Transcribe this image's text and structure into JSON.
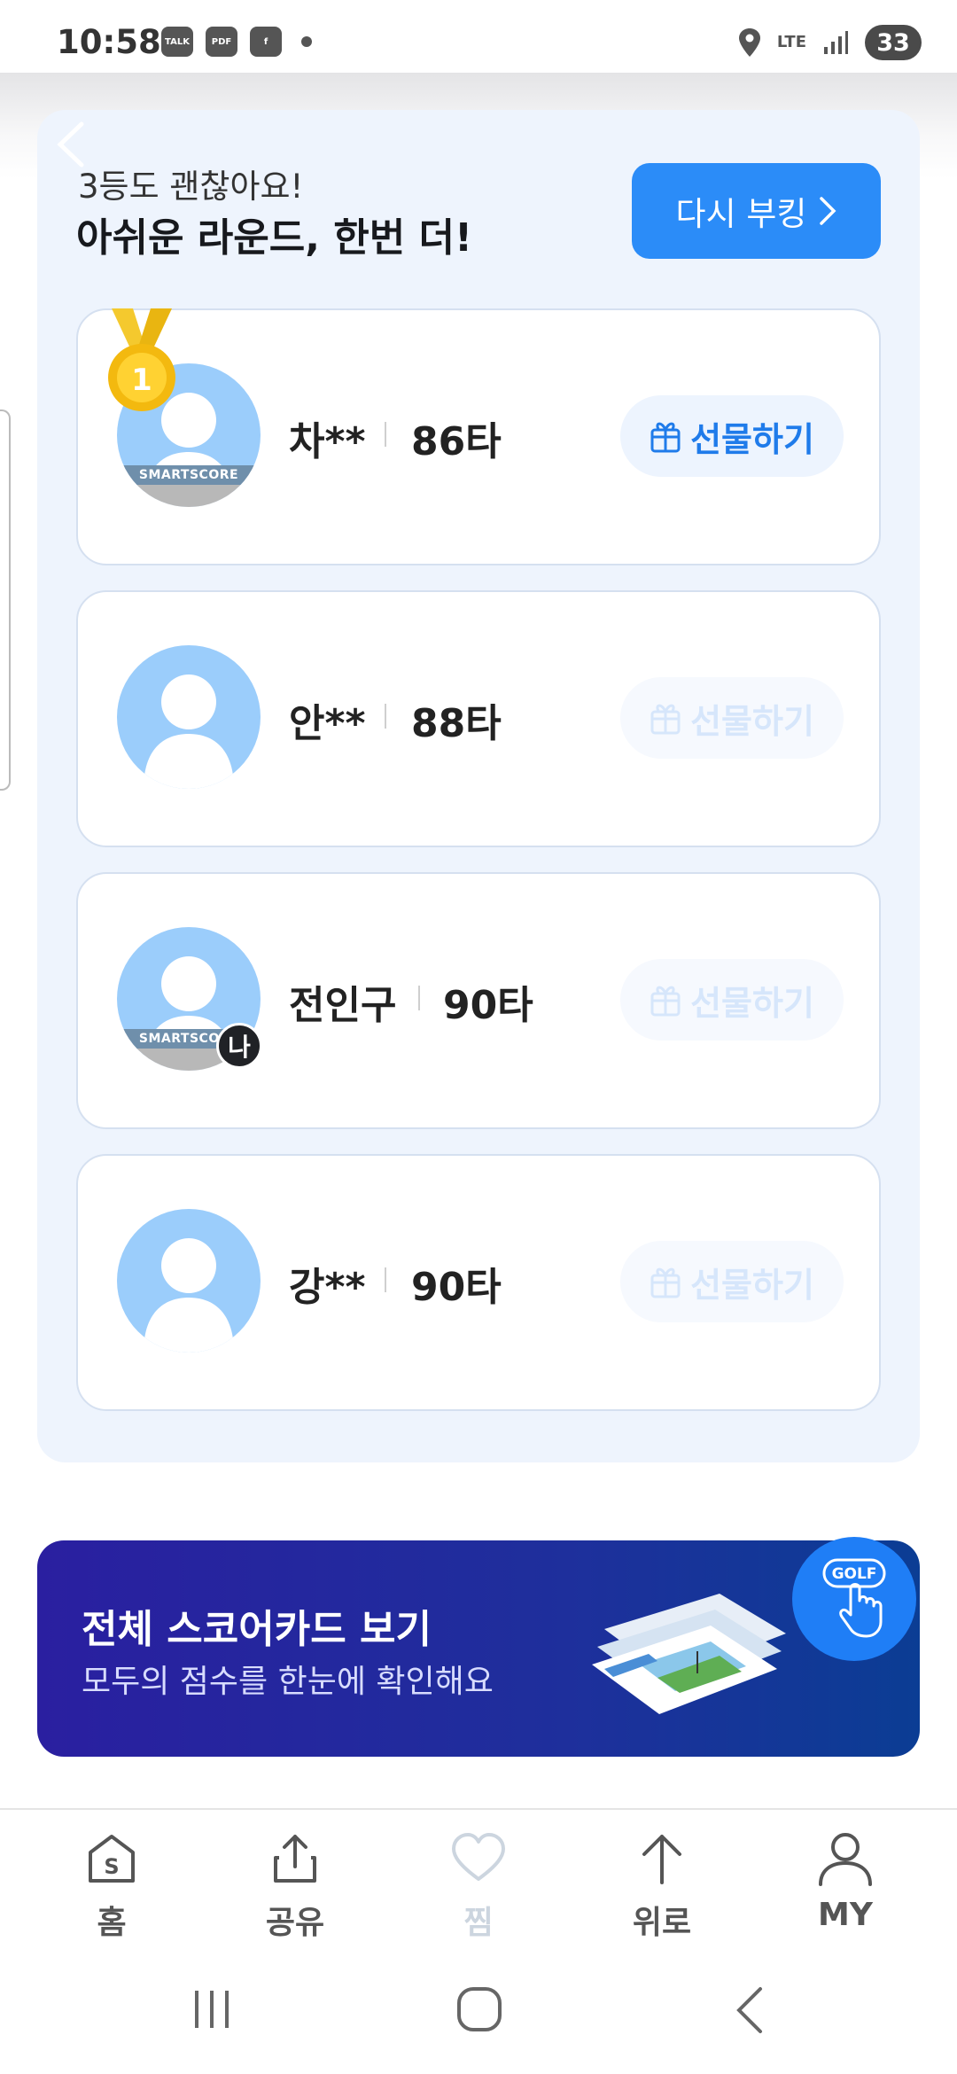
{
  "status_bar": {
    "time": "10:58",
    "network": "LTE",
    "battery": "33",
    "icons": [
      "talk-icon",
      "pdf-icon",
      "facebook-chat-icon",
      "location-icon",
      "signal-icon"
    ]
  },
  "header": {
    "subtitle": "3등도 괜찮아요!",
    "title": "아쉬운 라운드, 한번 더!",
    "rebook_label": "다시 부킹"
  },
  "players": [
    {
      "name": "차**",
      "score": "86타",
      "gift_label": "선물하기",
      "gift_enabled": true,
      "medal": "1",
      "smartscore": "SMARTSCORE",
      "me": false
    },
    {
      "name": "안**",
      "score": "88타",
      "gift_label": "선물하기",
      "gift_enabled": false,
      "me": false
    },
    {
      "name": "전인구",
      "score": "90타",
      "gift_label": "선물하기",
      "gift_enabled": false,
      "smartscore": "SMARTSCORE",
      "me": true,
      "me_label": "나"
    },
    {
      "name": "강**",
      "score": "90타",
      "gift_label": "선물하기",
      "gift_enabled": false,
      "me": false
    }
  ],
  "banner": {
    "title": "전체 스코어카드 보기",
    "subtitle": "모두의 점수를 한눈에 확인해요",
    "fab_label": "GOLF"
  },
  "bottom_nav": [
    {
      "label": "홈",
      "icon": "home-s-icon",
      "dim": false
    },
    {
      "label": "공유",
      "icon": "share-icon",
      "dim": false
    },
    {
      "label": "찜",
      "icon": "heart-icon",
      "dim": true
    },
    {
      "label": "위로",
      "icon": "arrow-up-icon",
      "dim": false
    },
    {
      "label": "MY",
      "icon": "person-icon",
      "dim": false
    }
  ],
  "colors": {
    "accent": "#2b8cf8",
    "panel_bg": "#eef4fd",
    "avatar": "#9bcdfb",
    "banner": "#22249d"
  }
}
